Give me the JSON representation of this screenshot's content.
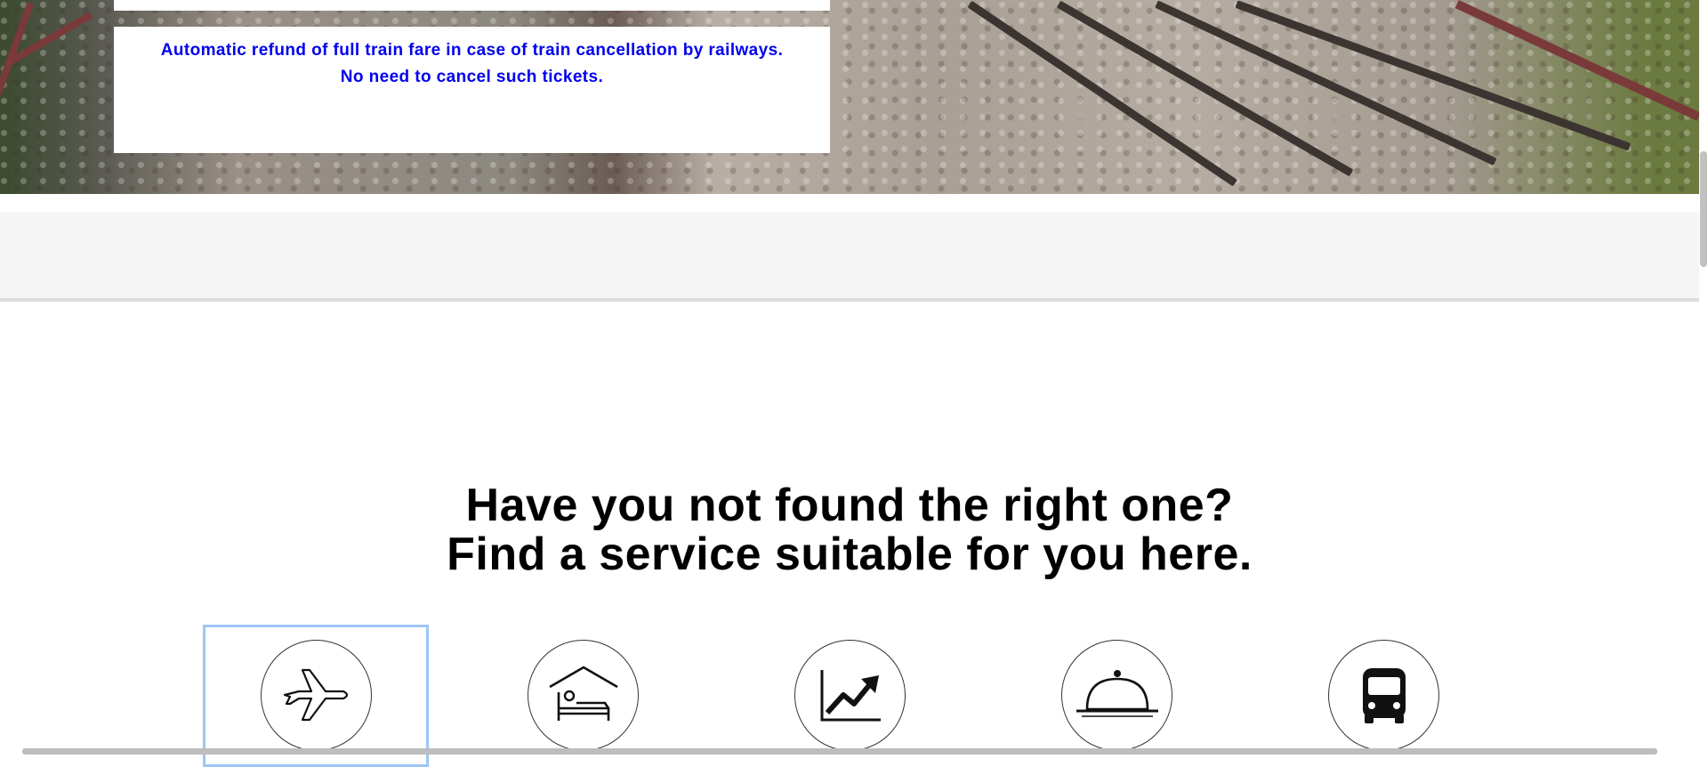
{
  "notice": {
    "line1": "Automatic refund of full train fare in case of train cancellation by railways.",
    "line2": "No need to cancel such tickets."
  },
  "headline": {
    "line1": "Have you not found the right one?",
    "line2": "Find a service suitable for you here."
  },
  "services": [
    {
      "icon": "airplane-icon"
    },
    {
      "icon": "hotel-bed-icon"
    },
    {
      "icon": "trend-chart-icon"
    },
    {
      "icon": "food-cloche-icon"
    },
    {
      "icon": "bus-icon"
    }
  ],
  "colors": {
    "notice_text": "#0000ee",
    "focus_outline": "#9cc6f5"
  }
}
